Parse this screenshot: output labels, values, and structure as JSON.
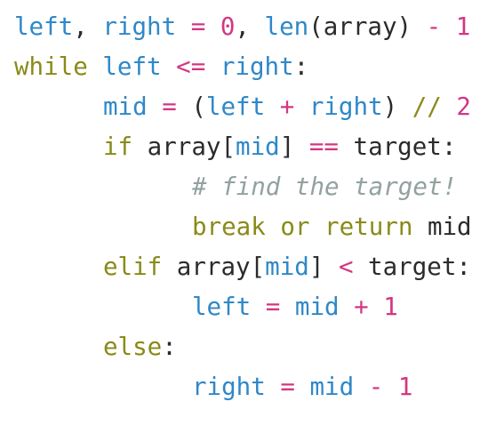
{
  "colors": {
    "variable": "#2f88c8",
    "keyword": "#8a8a1a",
    "number": "#d33682",
    "operator": "#d33682",
    "comment": "#93a1a1",
    "plain": "#2b2b2b"
  },
  "lines": [
    {
      "indent": 0,
      "tokens": [
        {
          "text": "left",
          "kind": "variable"
        },
        {
          "text": ", ",
          "kind": "plain"
        },
        {
          "text": "right",
          "kind": "variable"
        },
        {
          "text": " = ",
          "kind": "operator"
        },
        {
          "text": "0",
          "kind": "number"
        },
        {
          "text": ", ",
          "kind": "plain"
        },
        {
          "text": "len",
          "kind": "variable"
        },
        {
          "text": "(array) ",
          "kind": "plain"
        },
        {
          "text": "-",
          "kind": "operator"
        },
        {
          "text": " 1",
          "kind": "number"
        }
      ]
    },
    {
      "indent": 0,
      "tokens": [
        {
          "text": "while",
          "kind": "keyword"
        },
        {
          "text": " ",
          "kind": "plain"
        },
        {
          "text": "left",
          "kind": "variable"
        },
        {
          "text": " <= ",
          "kind": "operator"
        },
        {
          "text": "right",
          "kind": "variable"
        },
        {
          "text": ":",
          "kind": "plain"
        }
      ]
    },
    {
      "indent": 1,
      "tokens": [
        {
          "text": "mid",
          "kind": "variable"
        },
        {
          "text": " = ",
          "kind": "operator"
        },
        {
          "text": "(",
          "kind": "plain"
        },
        {
          "text": "left",
          "kind": "variable"
        },
        {
          "text": " + ",
          "kind": "operator"
        },
        {
          "text": "right",
          "kind": "variable"
        },
        {
          "text": ") ",
          "kind": "plain"
        },
        {
          "text": "//",
          "kind": "keyword"
        },
        {
          "text": " 2",
          "kind": "number"
        }
      ]
    },
    {
      "indent": 1,
      "tokens": [
        {
          "text": "if",
          "kind": "keyword"
        },
        {
          "text": " array[",
          "kind": "plain"
        },
        {
          "text": "mid",
          "kind": "variable"
        },
        {
          "text": "] ",
          "kind": "plain"
        },
        {
          "text": "==",
          "kind": "operator"
        },
        {
          "text": " target:",
          "kind": "plain"
        }
      ]
    },
    {
      "indent": 2,
      "tokens": [
        {
          "text": "# find the target!",
          "kind": "comment"
        }
      ]
    },
    {
      "indent": 2,
      "tokens": [
        {
          "text": "break",
          "kind": "keyword"
        },
        {
          "text": " ",
          "kind": "plain"
        },
        {
          "text": "or",
          "kind": "keyword"
        },
        {
          "text": " ",
          "kind": "plain"
        },
        {
          "text": "return",
          "kind": "keyword"
        },
        {
          "text": " mid",
          "kind": "plain"
        }
      ]
    },
    {
      "indent": 1,
      "tokens": [
        {
          "text": "elif",
          "kind": "keyword"
        },
        {
          "text": " array[",
          "kind": "plain"
        },
        {
          "text": "mid",
          "kind": "variable"
        },
        {
          "text": "] ",
          "kind": "plain"
        },
        {
          "text": "<",
          "kind": "operator"
        },
        {
          "text": " target:",
          "kind": "plain"
        }
      ]
    },
    {
      "indent": 2,
      "tokens": [
        {
          "text": "left",
          "kind": "variable"
        },
        {
          "text": " = ",
          "kind": "operator"
        },
        {
          "text": "mid",
          "kind": "variable"
        },
        {
          "text": " + ",
          "kind": "operator"
        },
        {
          "text": "1",
          "kind": "number"
        }
      ]
    },
    {
      "indent": 1,
      "tokens": [
        {
          "text": "else",
          "kind": "keyword"
        },
        {
          "text": ":",
          "kind": "plain"
        }
      ]
    },
    {
      "indent": 2,
      "tokens": [
        {
          "text": "right",
          "kind": "variable"
        },
        {
          "text": " = ",
          "kind": "operator"
        },
        {
          "text": "mid",
          "kind": "variable"
        },
        {
          "text": " - ",
          "kind": "operator"
        },
        {
          "text": "1",
          "kind": "number"
        }
      ]
    }
  ]
}
